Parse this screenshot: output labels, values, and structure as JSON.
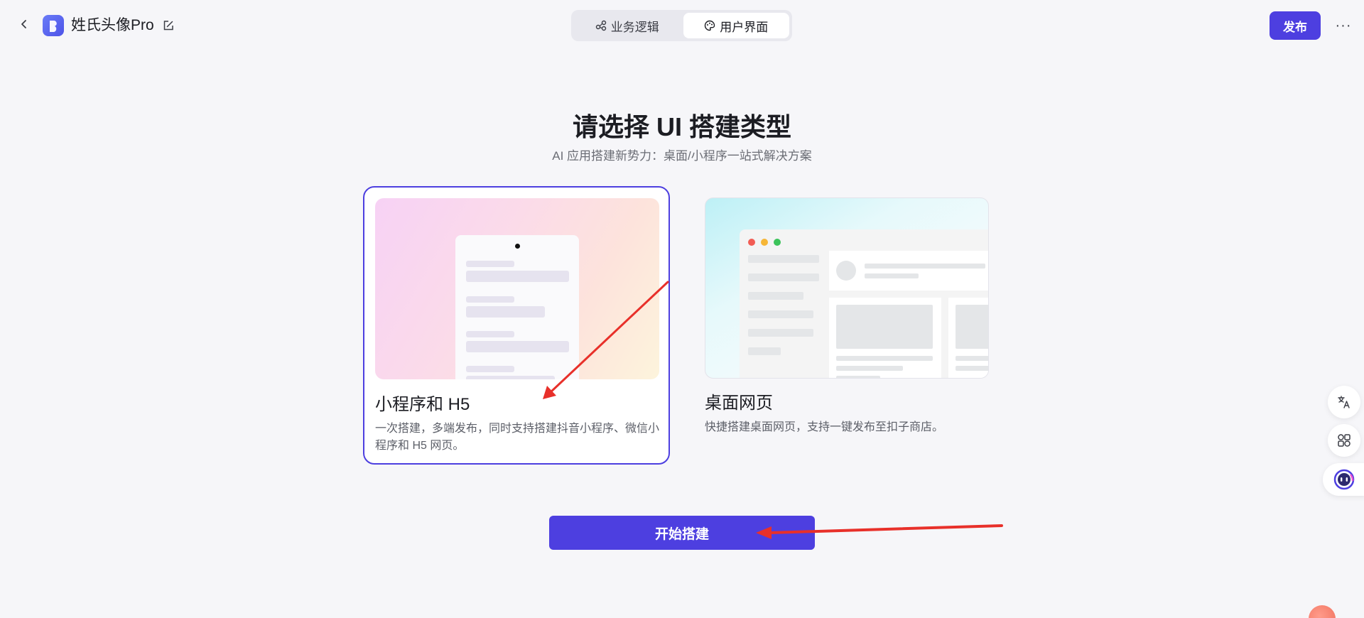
{
  "header": {
    "app_title": "姓氏头像Pro",
    "tabs": [
      {
        "label": "业务逻辑",
        "icon": "flow-icon",
        "active": false
      },
      {
        "label": "用户界面",
        "icon": "palette-icon",
        "active": true
      }
    ],
    "publish_label": "发布",
    "more_label": "···"
  },
  "main": {
    "title": "请选择 UI 搭建类型",
    "subtitle": "AI 应用搭建新势力：桌面/小程序一站式解决方案"
  },
  "cards": [
    {
      "title": "小程序和 H5",
      "description": "一次搭建，多端发布，同时支持搭建抖音小程序、微信小程序和 H5 网页。",
      "selected": true
    },
    {
      "title": "桌面网页",
      "description": "快捷搭建桌面网页，支持一键发布至扣子商店。",
      "selected": false
    }
  ],
  "start_button_label": "开始搭建",
  "side_tools": [
    "translate-icon",
    "apps-icon",
    "assistant-icon"
  ],
  "colors": {
    "accent": "#4d3fe0",
    "background": "#f6f6f9",
    "annotation_arrow": "#e8302a"
  }
}
